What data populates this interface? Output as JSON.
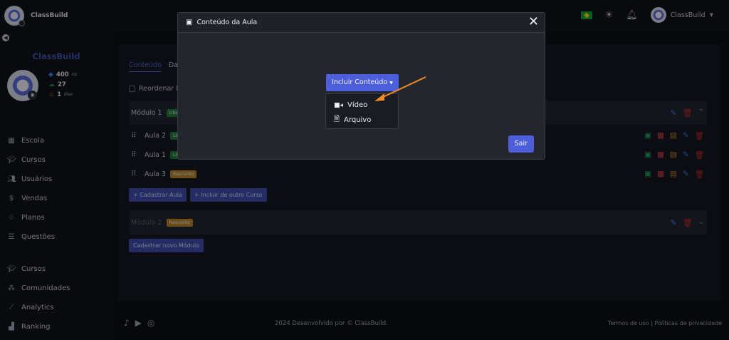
{
  "app": {
    "brand": "ClassBuild"
  },
  "topbar": {
    "user_name": "ClassBuild",
    "icons": [
      "flag-brazil-icon",
      "sun-icon",
      "bell-icon",
      "user-avatar"
    ]
  },
  "sidebar": {
    "brand": "ClassBuild",
    "stats": {
      "xp_value": "400",
      "xp_unit": "xp",
      "leaves": "27",
      "streak_value": "1",
      "streak_unit": "dias"
    },
    "menu": [
      {
        "label": "Escola",
        "icon": "building-icon"
      },
      {
        "label": "Cursos",
        "icon": "graduation-cap-icon"
      },
      {
        "label": "Usuários",
        "icon": "users-icon"
      },
      {
        "label": "Vendas",
        "icon": "dollar-icon"
      },
      {
        "label": "Planos",
        "icon": "hierarchy-icon"
      },
      {
        "label": "Questões",
        "icon": "database-icon"
      }
    ],
    "menu2": [
      {
        "label": "Cursos",
        "icon": "graduation-cap-icon"
      },
      {
        "label": "Comunidades",
        "icon": "community-icon"
      },
      {
        "label": "Analytics",
        "icon": "chart-line-icon"
      },
      {
        "label": "Ranking",
        "icon": "podium-icon"
      }
    ]
  },
  "main": {
    "tabs": [
      "Conteúdo",
      "Da"
    ],
    "reorder_label": "Reordenar M",
    "modules": [
      {
        "title": "Módulo 1",
        "badge": "Libe",
        "badge_color": "#1e7a3a"
      },
      {
        "title": "Módulo 2",
        "badge": "Rascunho",
        "badge_color": "#b9852b"
      }
    ],
    "lessons": [
      {
        "title": "Aula 2",
        "badge": "Libe"
      },
      {
        "title": "Aula 1",
        "badge": "Libe"
      },
      {
        "title": "Aula 3",
        "badge": "Rascunho"
      }
    ],
    "add_lesson_label": "+ Cadastrar Aula",
    "include_other_label": "+ Incluir de outro Curso",
    "add_module_label": "Cadastrar novo Módulo"
  },
  "footer": {
    "copyright": "2024 Desenvolvido por © ClassBuild.",
    "links": "Termos de uso | Políticas de privacidade"
  },
  "modal": {
    "title": "Conteúdo da Aula",
    "include_button": "Incluir Conteúdo",
    "dropdown_items": [
      {
        "label": "Vídeo",
        "icon": "video-camera-icon"
      },
      {
        "label": "Arquivo",
        "icon": "file-pdf-icon"
      }
    ],
    "exit_button": "Sair"
  },
  "colors": {
    "accent": "#4c5ed9",
    "annotation_arrow": "#f08a24",
    "success": "#1e7a3a",
    "draft": "#b9852b",
    "danger": "#c52b2b"
  }
}
